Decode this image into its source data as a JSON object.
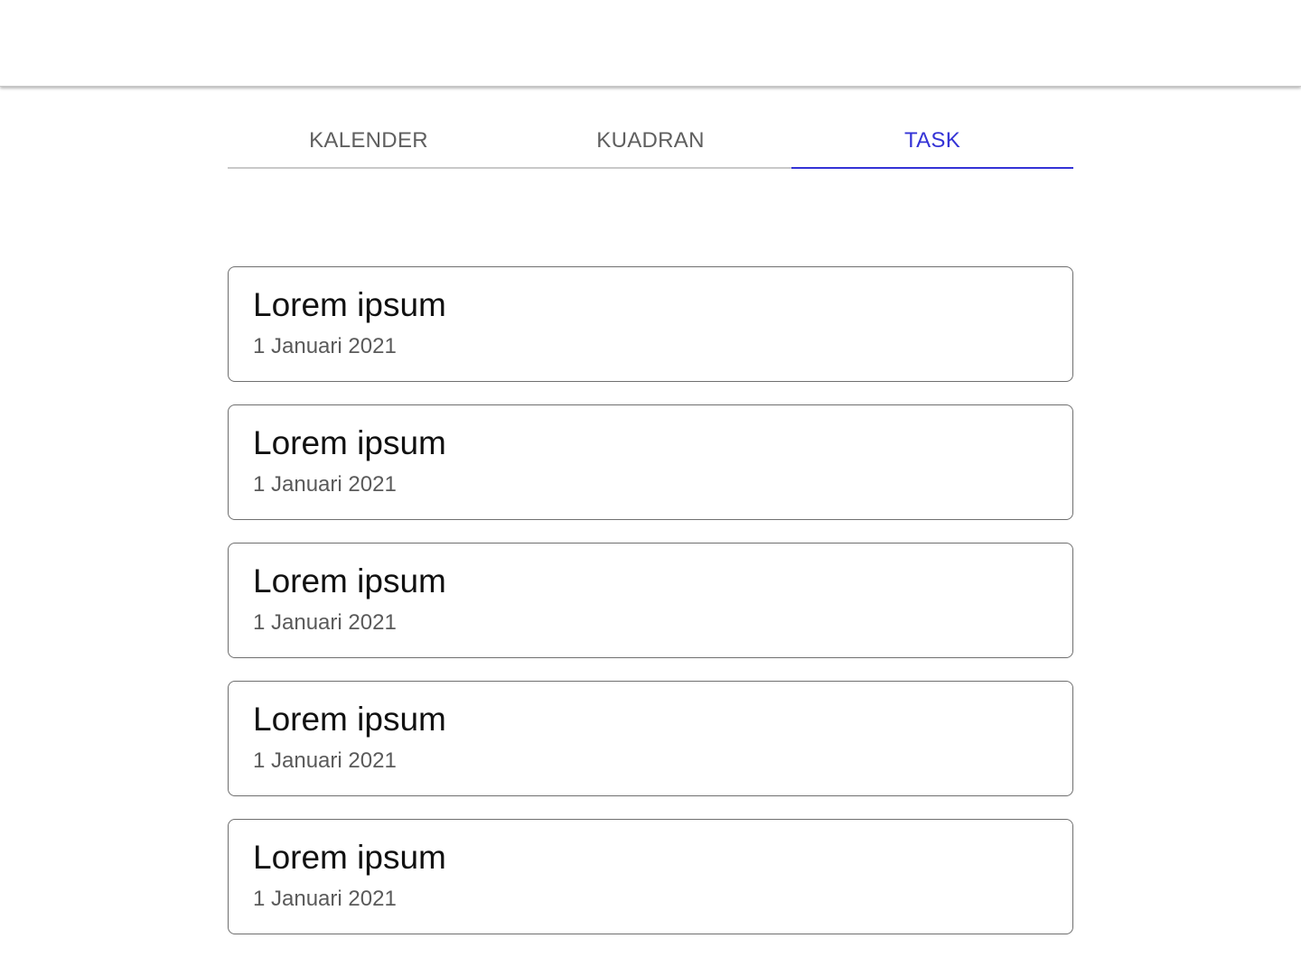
{
  "tabs": [
    {
      "label": "KALENDER",
      "active": false
    },
    {
      "label": "KUADRAN",
      "active": false
    },
    {
      "label": "TASK",
      "active": true
    }
  ],
  "colors": {
    "accent": "#3433d6",
    "tab_inactive": "#5f5f5f",
    "card_border": "#6f6f6f"
  },
  "tasks": [
    {
      "title": "Lorem ipsum",
      "date": "1 Januari 2021"
    },
    {
      "title": "Lorem ipsum",
      "date": "1 Januari 2021"
    },
    {
      "title": "Lorem ipsum",
      "date": "1 Januari 2021"
    },
    {
      "title": "Lorem ipsum",
      "date": "1 Januari 2021"
    },
    {
      "title": "Lorem ipsum",
      "date": "1 Januari 2021"
    }
  ]
}
